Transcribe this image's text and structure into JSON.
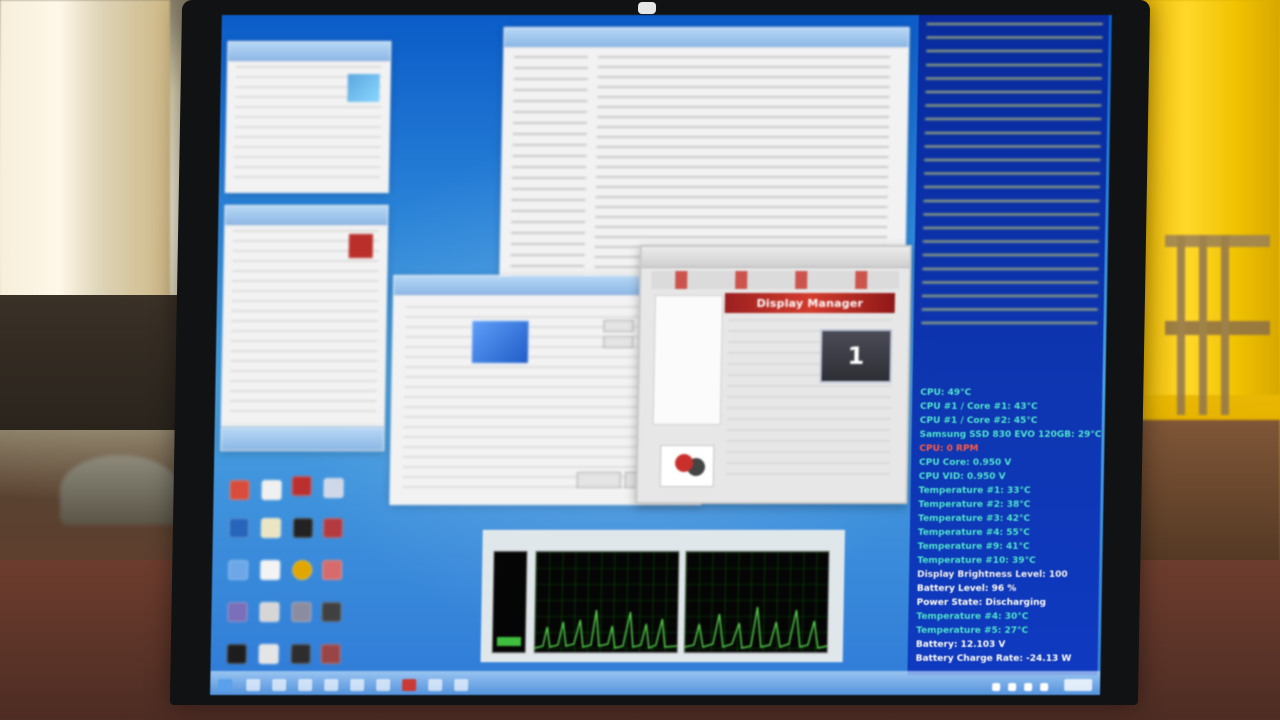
{
  "display_manager": {
    "title": "Display Manager",
    "preview_number": "1"
  },
  "overlay": {
    "lines": [
      {
        "text": "CPU: 49°C",
        "color": "cyan"
      },
      {
        "text": "CPU #1 / Core #1: 43°C",
        "color": "cyan"
      },
      {
        "text": "CPU #1 / Core #2: 45°C",
        "color": "cyan"
      },
      {
        "text": "Samsung SSD 830 EVO 120GB: 29°C",
        "color": "cyan"
      },
      {
        "text": "CPU: 0 RPM",
        "color": "red"
      },
      {
        "text": "CPU Core: 0.950 V",
        "color": "cyan"
      },
      {
        "text": "CPU VID: 0.950 V",
        "color": "cyan"
      },
      {
        "text": "Temperature #1: 33°C",
        "color": "cyan"
      },
      {
        "text": "Temperature #2: 38°C",
        "color": "cyan"
      },
      {
        "text": "Temperature #3: 42°C",
        "color": "cyan"
      },
      {
        "text": "Temperature #4: 55°C",
        "color": "cyan"
      },
      {
        "text": "Temperature #9: 41°C",
        "color": "cyan"
      },
      {
        "text": "Temperature #10: 39°C",
        "color": "cyan"
      },
      {
        "text": "Display Brightness Level: 100",
        "color": "bright"
      },
      {
        "text": "Battery Level: 96 %",
        "color": "white"
      },
      {
        "text": "Power State: Discharging",
        "color": "white"
      },
      {
        "text": "Temperature #4: 30°C",
        "color": "cyan"
      },
      {
        "text": "Temperature #5: 27°C",
        "color": "cyan"
      },
      {
        "text": "Battery: 12.103 V",
        "color": "white"
      },
      {
        "text": "Battery Charge Rate: -24.13 W",
        "color": "white"
      }
    ]
  }
}
